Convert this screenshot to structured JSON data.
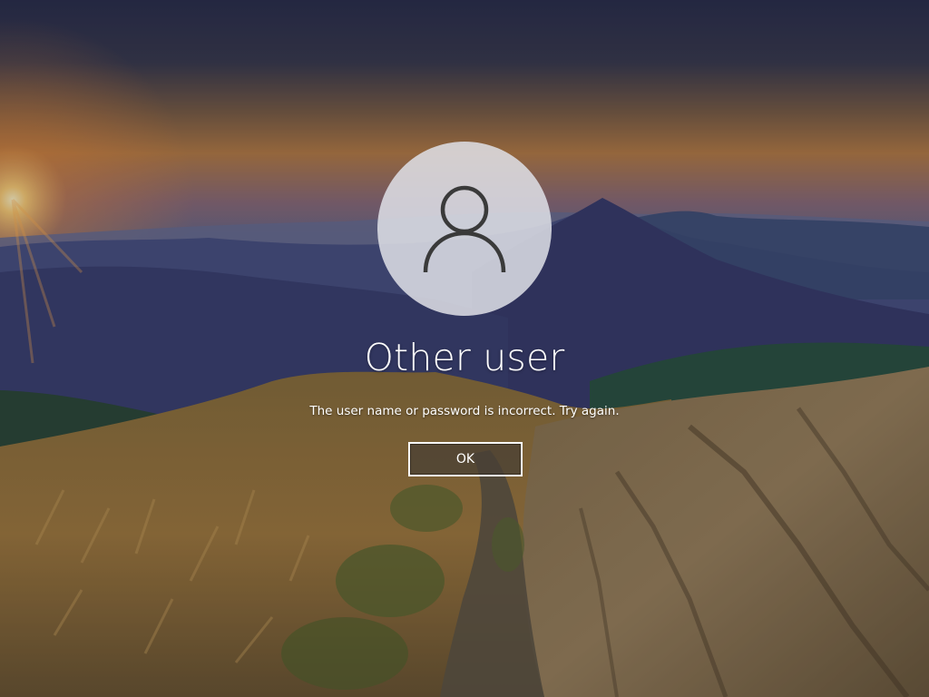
{
  "lock_screen": {
    "user": {
      "name": "Other user",
      "avatar_icon": "user-silhouette-icon"
    },
    "error_message": "The user name or password is incorrect. Try again.",
    "ok_button": {
      "label": "OK"
    },
    "background": {
      "subject": "mountain sunset landscape wallpaper"
    }
  },
  "colors": {
    "text": "#ffffff",
    "avatar_circle": "#dfe1e6",
    "avatar_icon": "#3a3a3a",
    "button_border": "#ffffff",
    "button_fill": "#463e34",
    "sky_top": "#2c3050",
    "sunset_glow": "#f0a446"
  }
}
